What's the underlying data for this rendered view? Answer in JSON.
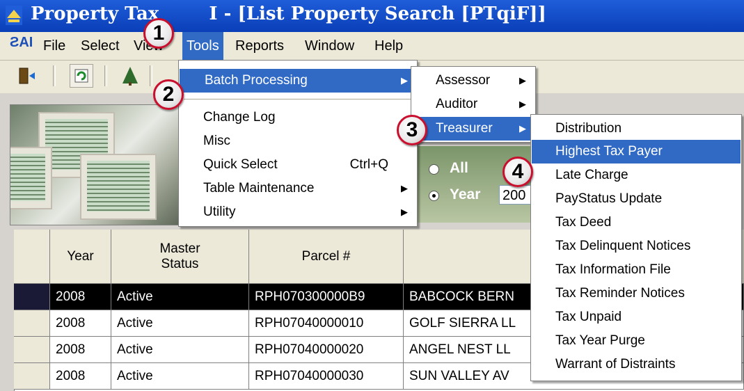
{
  "window": {
    "title": "Property Tax GUI - [List Property Search [PTqiF]]",
    "title_visible": "Property Tax",
    "title_visible_tail": "I - [List Property Search [PTqiF]]"
  },
  "menubar": {
    "logo": "ƧAI",
    "items": [
      "File",
      "Select",
      "View",
      "Tools",
      "Reports",
      "Window",
      "Help"
    ],
    "active": "Tools"
  },
  "tools_menu": {
    "items": [
      {
        "label": "Batch Processing",
        "submenu": true,
        "highlighted": true
      },
      {
        "label": "Change Log"
      },
      {
        "label": "Misc"
      },
      {
        "label": "Quick Select",
        "shortcut": "Ctrl+Q"
      },
      {
        "label": "Table Maintenance",
        "submenu": true
      },
      {
        "label": "Utility",
        "submenu": true
      }
    ]
  },
  "batch_menu": {
    "items": [
      {
        "label": "Assessor",
        "submenu": true
      },
      {
        "label": "Auditor",
        "submenu": true
      },
      {
        "label": "Treasurer",
        "submenu": true,
        "highlighted": true
      }
    ]
  },
  "treasurer_menu": {
    "items": [
      "Distribution",
      "Highest Tax Payer",
      "Late Charge",
      "PayStatus Update",
      "Tax Deed",
      "Tax Delinquent Notices",
      "Tax Information File",
      "Tax Reminder Notices",
      "Tax Unpaid",
      "Tax Year Purge",
      "Warrant of Distraints"
    ],
    "highlighted": "Highest Tax Payer"
  },
  "filter": {
    "all_label": "All",
    "year_label": "Year",
    "year_value": "200",
    "selected": "Year"
  },
  "grid": {
    "headers": [
      "Year",
      "Master\nStatus",
      "Parcel #",
      ""
    ],
    "rows": [
      [
        "2008",
        "Active",
        "RPH070300000B9",
        "BABCOCK BERN"
      ],
      [
        "2008",
        "Active",
        "RPH07040000010",
        "GOLF SIERRA LL"
      ],
      [
        "2008",
        "Active",
        "RPH07040000020",
        "ANGEL NEST LL"
      ],
      [
        "2008",
        "Active",
        "RPH07040000030",
        "SUN VALLEY AV"
      ]
    ],
    "selected_row": 0
  },
  "callouts": [
    "1",
    "2",
    "3",
    "4"
  ],
  "icons": [
    "app-icon",
    "exit-icon",
    "refresh-icon",
    "tree-icon",
    "submenu-arrow-icon"
  ],
  "colors": {
    "highlight": "#316ac5",
    "titlebar": "#0a3fb8",
    "callout_border": "#c8102e"
  }
}
